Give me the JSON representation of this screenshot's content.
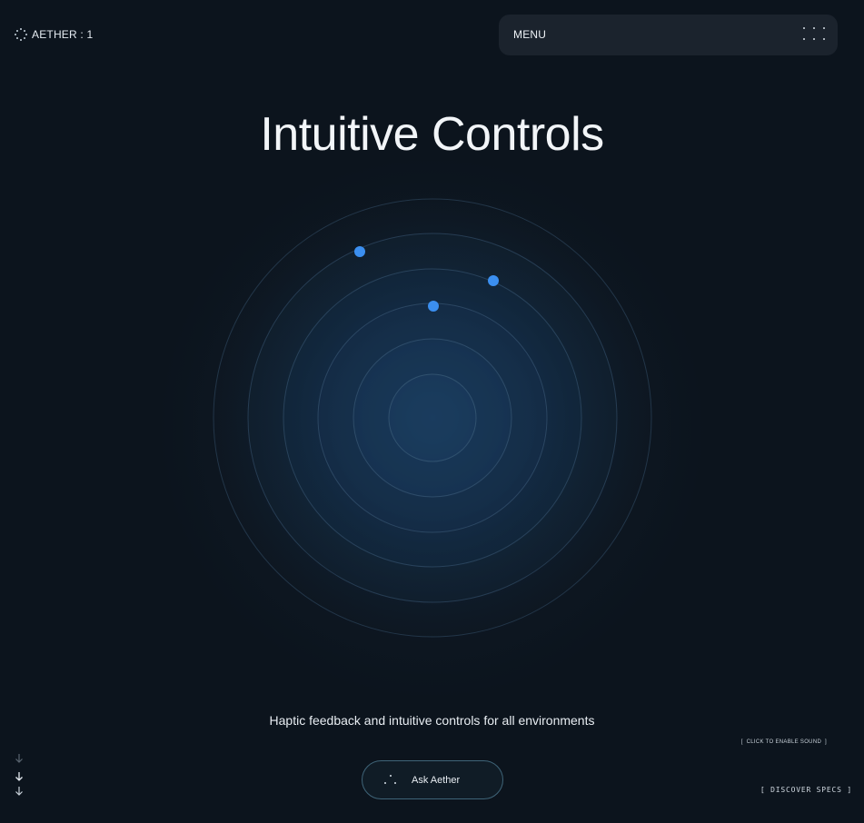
{
  "brand": {
    "name": "AETHER : 1",
    "icon": "sparkle-dots-icon"
  },
  "menu": {
    "label": "MENU",
    "icon": "grid-dots-icon"
  },
  "hero": {
    "title": "Intuitive Controls",
    "subtitle": "Haptic feedback and intuitive controls for all environments"
  },
  "radar": {
    "ring_count": 6,
    "dot_color": "#3b8ff0",
    "dot_count": 3
  },
  "sound": {
    "label": "[  CLICK TO ENABLE SOUND  ]"
  },
  "ask": {
    "label": "Ask Aether",
    "icon": "dots-icon"
  },
  "discover": {
    "label": "[ DISCOVER SPECS ]"
  },
  "scroll": {
    "icon": "arrow-down-icon"
  },
  "colors": {
    "background": "#0c141d",
    "menu_bg": "#1b232d",
    "accent": "#3b8ff0",
    "button_border": "#3f6478"
  }
}
